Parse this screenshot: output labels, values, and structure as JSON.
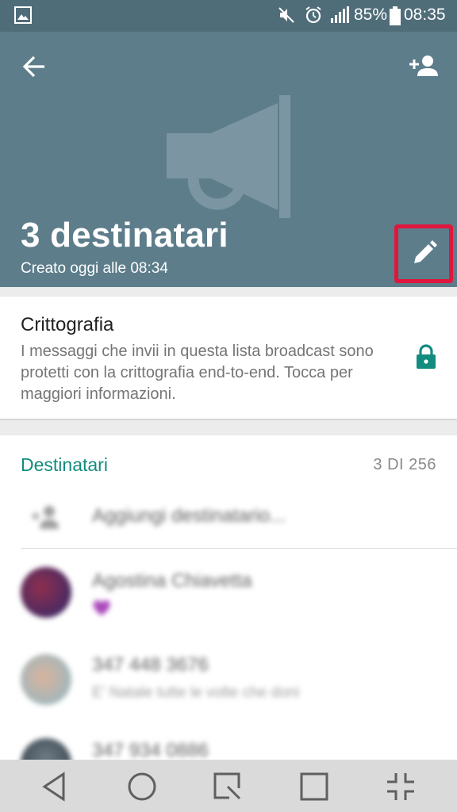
{
  "status_bar": {
    "battery": "85%",
    "time": "08:35"
  },
  "header": {
    "title": "3 destinatari",
    "subtitle": "Creato oggi alle 08:34",
    "color": "#5d7d8b"
  },
  "encryption": {
    "title": "Crittografia",
    "body": "I messaggi che invii in questa lista broadcast sono protetti con la crittografia end-to-end. Tocca per maggiori informazioni.",
    "accent": "#128c7e"
  },
  "recipients": {
    "heading": "Destinatari",
    "count": "3 DI 256",
    "add_label": "Aggiungi destinatario...",
    "items": [
      {
        "name": "Agostina Chiavetta",
        "status": "💜"
      },
      {
        "name": "347 448 3676",
        "status": "E' Natale tutte le volte che doni"
      },
      {
        "name": "347 934 0886",
        "status": ""
      }
    ]
  },
  "icons": [
    "gallery-icon",
    "mute-icon",
    "alarm-icon",
    "signal-icon",
    "battery-icon",
    "back-arrow-icon",
    "add-person-icon",
    "broadcast-megaphone-icon",
    "pencil-icon",
    "lock-icon",
    "add-recipient-icon",
    "nav-back-icon",
    "nav-home-icon",
    "nav-quickmemo-icon",
    "nav-recents-icon",
    "nav-minimize-icon"
  ]
}
